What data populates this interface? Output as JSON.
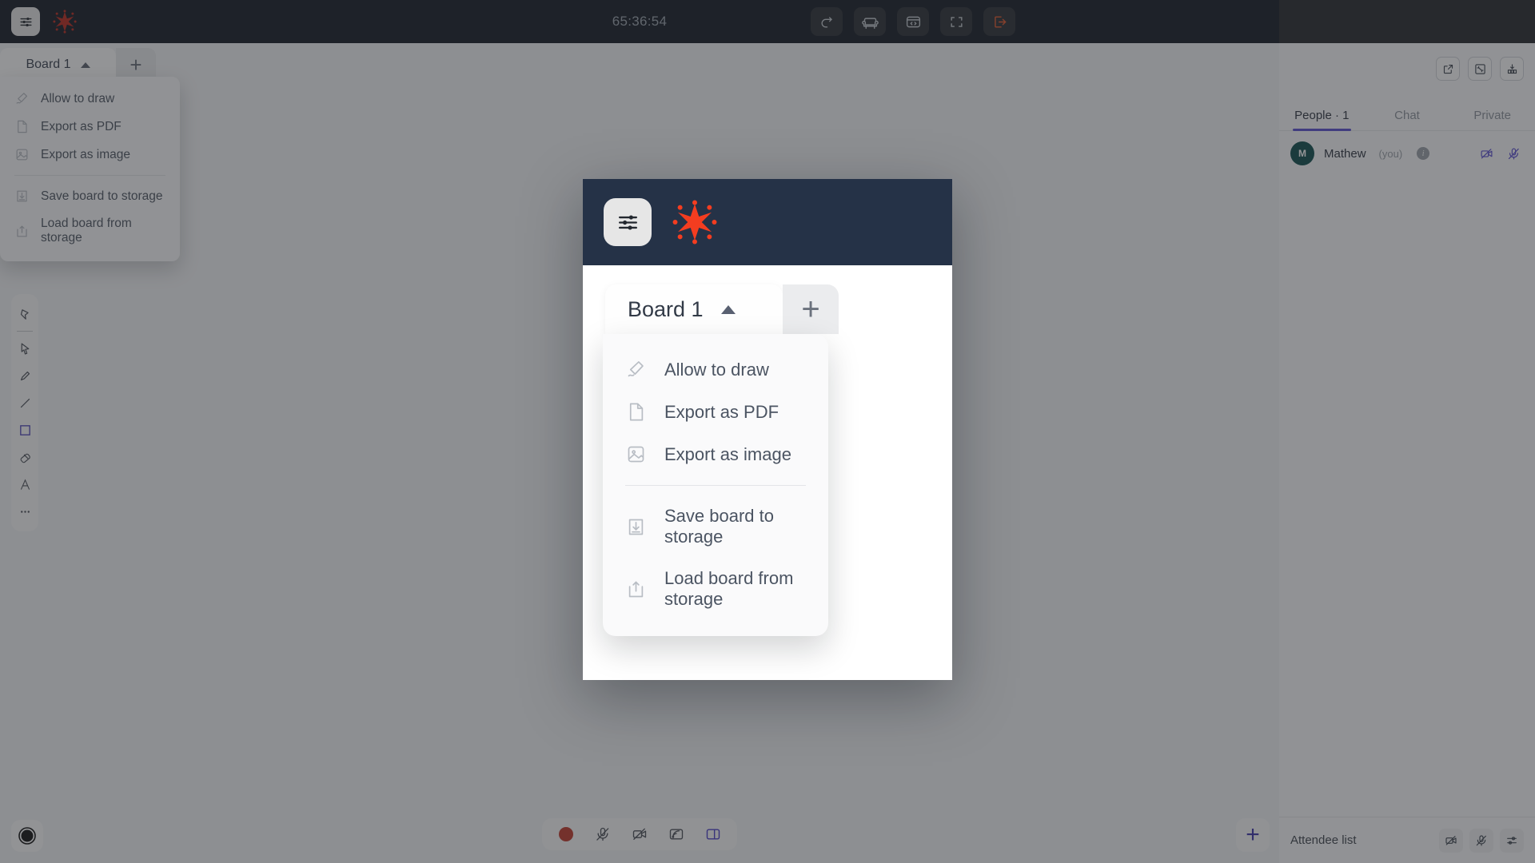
{
  "topbar": {
    "settings_icon": "sliders-icon",
    "logo_icon": "brand-star-logo",
    "timer": "65:36:54",
    "actions": [
      {
        "name": "redo-button",
        "icon": "redo-icon"
      },
      {
        "name": "lounge-button",
        "icon": "sofa-icon"
      },
      {
        "name": "embed-code-button",
        "icon": "code-window-icon"
      },
      {
        "name": "fullscreen-button",
        "icon": "fullscreen-icon"
      },
      {
        "name": "leave-button",
        "icon": "exit-icon"
      }
    ],
    "leave_color": "#e2572a"
  },
  "board": {
    "tab_label": "Board 1",
    "add_label": "+"
  },
  "menu": {
    "items": [
      {
        "label": "Allow to draw",
        "icon": "pen-icon"
      },
      {
        "label": "Export as PDF",
        "icon": "file-icon"
      },
      {
        "label": "Export as image",
        "icon": "image-icon"
      },
      {
        "label": "Save board to storage",
        "icon": "download-box-icon"
      },
      {
        "label": "Load board from storage",
        "icon": "upload-box-icon"
      }
    ],
    "separator_after_index": 2
  },
  "toolbar": {
    "tools": [
      {
        "name": "sticky-note-tool",
        "icon": "sticky-note-icon",
        "selected": false
      },
      {
        "name": "select-tool",
        "icon": "cursor-icon",
        "selected": false
      },
      {
        "name": "pencil-tool",
        "icon": "pencil-icon",
        "selected": false
      },
      {
        "name": "line-tool",
        "icon": "line-icon",
        "selected": false
      },
      {
        "name": "rectangle-tool",
        "icon": "square-icon",
        "selected": true
      },
      {
        "name": "eraser-tool",
        "icon": "eraser-icon",
        "selected": false
      },
      {
        "name": "text-tool",
        "icon": "text-a-icon",
        "selected": false
      },
      {
        "name": "more-tools",
        "icon": "ellipsis-icon",
        "selected": false
      }
    ],
    "selected_color": "#4e45b8"
  },
  "right_panel": {
    "header_actions": [
      {
        "name": "popout-button",
        "icon": "external-link-icon"
      },
      {
        "name": "collapse-button",
        "icon": "collapse-arrows-icon"
      },
      {
        "name": "layout-button",
        "icon": "layout-grid-icon"
      }
    ],
    "tabs": [
      {
        "label": "People · 1",
        "active": true
      },
      {
        "label": "Chat",
        "active": false
      },
      {
        "label": "Private",
        "active": false
      }
    ],
    "accent": "#5b4fd0",
    "person": {
      "initial": "M",
      "name": "Mathew",
      "suffix": "(you)",
      "info_badge": "i",
      "actions": [
        {
          "name": "camera-off-button",
          "icon": "camera-off-icon"
        },
        {
          "name": "mic-off-button",
          "icon": "mic-off-icon"
        }
      ]
    },
    "footer": {
      "label": "Attendee list",
      "actions": [
        {
          "name": "camera-off-all-button",
          "icon": "camera-off-icon"
        },
        {
          "name": "mic-off-all-button",
          "icon": "mic-off-icon"
        },
        {
          "name": "settings-button",
          "icon": "sliders-icon"
        }
      ]
    }
  },
  "bottom": {
    "left_button": {
      "name": "record-indicator",
      "icon": "circle-record-icon"
    },
    "center_buttons": [
      {
        "name": "record-button",
        "icon": "record-dot-icon"
      },
      {
        "name": "mic-toggle",
        "icon": "mic-off-icon"
      },
      {
        "name": "camera-toggle",
        "icon": "camera-off-icon"
      },
      {
        "name": "screenshare-button",
        "icon": "cast-icon"
      },
      {
        "name": "panel-toggle",
        "icon": "sidebar-panel-icon"
      }
    ],
    "right_button": {
      "name": "add-button",
      "label": "+",
      "color": "#3b33a8"
    }
  },
  "magnified": {
    "note": "zoomed duplicate of the top-left region",
    "board_tab_label": "Board 1",
    "add_label": "+"
  }
}
